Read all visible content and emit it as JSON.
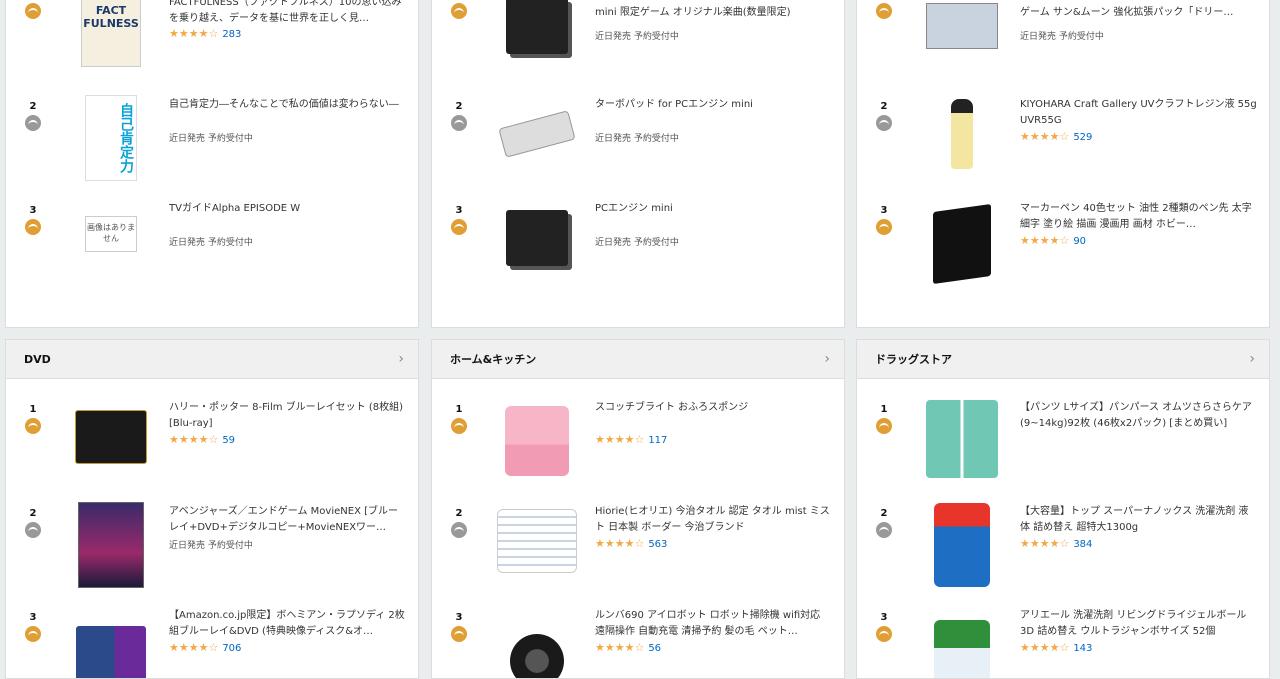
{
  "colors": {
    "medal_gold": "#e09f35",
    "medal_silver": "#999999",
    "star": "#f3a847",
    "link": "#0066c0"
  },
  "columns": [
    {
      "top_category": "",
      "top_items": [
        {
          "rank": "",
          "title": "FACTFULNESS（ファクトフルネス）10の思い込みを乗り越え、データを基に世界を正しく見…",
          "stars": "★★★★☆",
          "count": "283",
          "thumb_text": "FACT FULNESS",
          "thumb": "book"
        },
        {
          "rank": "2",
          "title": "自己肯定力―そんなことで私の価値は変わらない―",
          "release": "近日発売 予約受付中",
          "thumb_text": "自己肯定力",
          "thumb": "book2"
        },
        {
          "rank": "3",
          "title": "TVガイドAlpha EPISODE W",
          "release": "近日発売 予約受付中",
          "thumb_text": "画像はありません",
          "thumb": "noimg"
        }
      ],
      "category": "DVD",
      "items": [
        {
          "rank": "1",
          "title": "ハリー・ポッター 8-Film ブルーレイセット (8枚組) [Blu-ray]",
          "stars": "★★★★☆",
          "count": "59",
          "thumb": "dvdbox"
        },
        {
          "rank": "2",
          "title": "アベンジャーズ／エンドゲーム MovieNEX [ブルーレイ+DVD+デジタルコピー+MovieNEXワー…",
          "release": "近日発売 予約受付中",
          "thumb": "avengers"
        },
        {
          "rank": "3",
          "title": "【Amazon.co.jp限定】ボヘミアン・ラプソディ 2枚組ブルーレイ&DVD (特典映像ディスク&オ…",
          "stars": "★★★★☆",
          "count": "706",
          "thumb": "queen"
        }
      ]
    },
    {
      "top_category": "",
      "top_items": [
        {
          "rank": "",
          "title": "【アマゾン限定】PCエンジン mini + PCエンジン mini 限定ゲーム オリジナル楽曲(数量限定)",
          "release": "近日発売 予約受付中",
          "thumb": "console"
        },
        {
          "rank": "2",
          "title": "ターボパッド for PCエンジン mini",
          "release": "近日発売 予約受付中",
          "thumb": "pad"
        },
        {
          "rank": "3",
          "title": "PCエンジン mini",
          "release": "近日発売 予約受付中",
          "thumb": "console"
        }
      ],
      "category": "ホーム&キッチン",
      "items": [
        {
          "rank": "1",
          "title": "スコッチブライト おふろスポンジ",
          "stars": "★★★★☆",
          "count": "117",
          "thumb": "sponge"
        },
        {
          "rank": "2",
          "title": "Hiorie(ヒオリエ) 今治タオル 認定 タオル mist ミスト 日本製 ボーダー 今治ブランド",
          "stars": "★★★★☆",
          "count": "563",
          "thumb": "towel"
        },
        {
          "rank": "3",
          "title": "ルンバ690 アイロボット ロボット掃除機 wifi対応 遠隔操作 自動充電 清掃予約 髪の毛 ペット…",
          "stars": "★★★★☆",
          "count": "56",
          "thumb": "roomba"
        }
      ]
    },
    {
      "top_category": "",
      "top_items": [
        {
          "rank": "",
          "title": "【ライバル】デュエル・マスターズ ポケモンカードゲーム サン&ムーン 強化拡張パック「ドリー…",
          "release": "近日発売 予約受付中",
          "thumb": "cards"
        },
        {
          "rank": "2",
          "title": "KIYOHARA Craft Gallery UVクラフトレジン液 55g UVR55G",
          "stars": "★★★★☆",
          "count": "529",
          "thumb": "resin"
        },
        {
          "rank": "3",
          "title": "マーカーペン 40色セット 油性 2種類のペン先 太字 細字 塗り絵 描画 漫画用 画材 ホビー…",
          "stars": "★★★★☆",
          "count": "90",
          "thumb": "markers"
        }
      ],
      "category": "ドラッグストア",
      "items": [
        {
          "rank": "1",
          "title": "【パンツ Lサイズ】パンパース オムツさらさらケア (9~14kg)92枚 (46枚x2パック) [まとめ買い]",
          "stars": "",
          "count": "",
          "thumb": "pampers"
        },
        {
          "rank": "2",
          "title": "【大容量】トップ スーパーナノックス 洗濯洗剤 液体 詰め替え 超特大1300g",
          "stars": "★★★★☆",
          "count": "384",
          "thumb": "detergent"
        },
        {
          "rank": "3",
          "title": "アリエール 洗濯洗剤 リビングドライジェルボール3D 詰め替え ウルトラジャンボサイズ 52個",
          "stars": "★★★★☆",
          "count": "143",
          "thumb": "ariel"
        }
      ]
    }
  ]
}
